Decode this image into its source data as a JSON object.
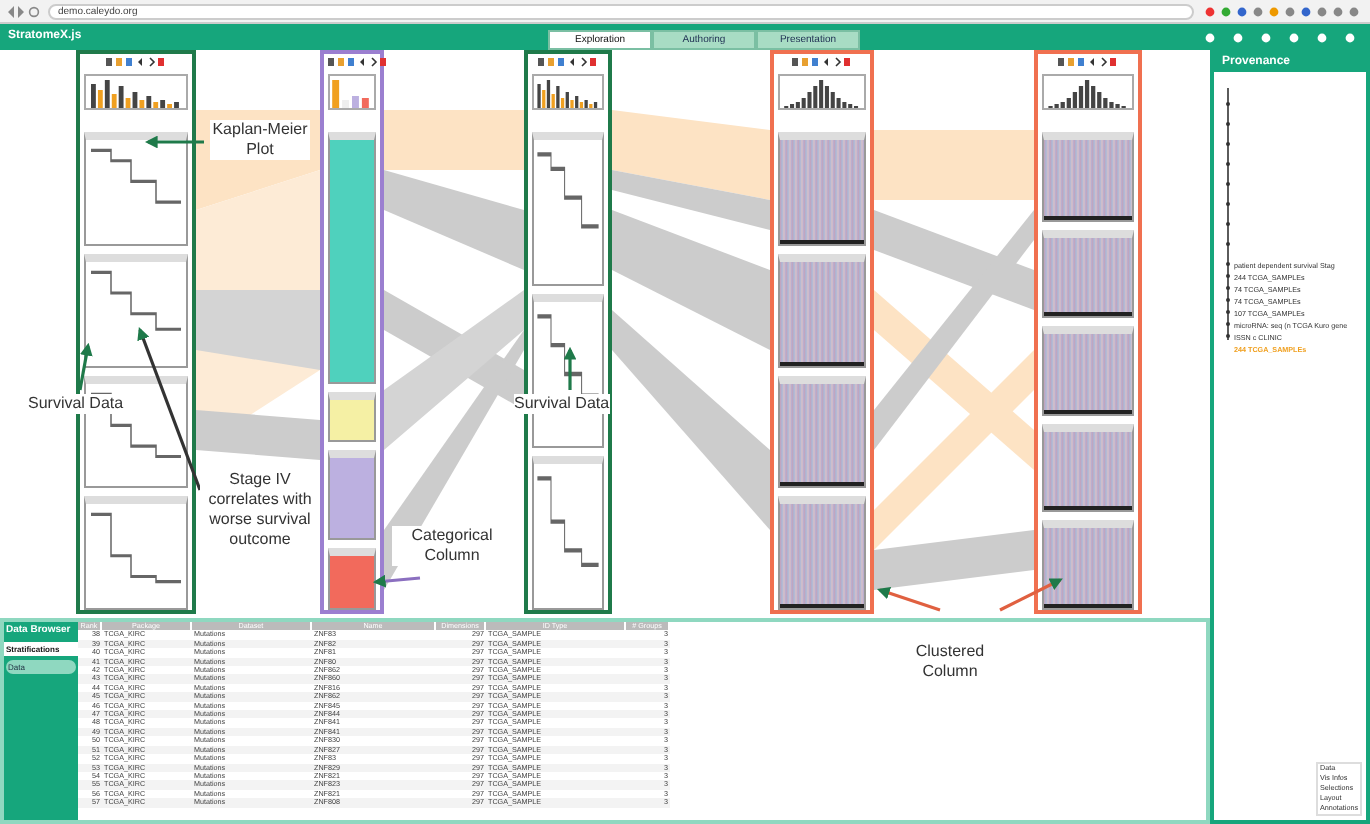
{
  "browser": {
    "url": "demo.caleydo.org"
  },
  "app": {
    "title": "StratomeX.js"
  },
  "tabs": [
    {
      "label": "Exploration",
      "selected": true
    },
    {
      "label": "Authoring",
      "selected": false
    },
    {
      "label": "Presentation",
      "selected": false
    }
  ],
  "columns": [
    {
      "kind": "survival",
      "groups": [
        {
          "kind": "km"
        },
        {
          "kind": "km"
        },
        {
          "kind": "km"
        },
        {
          "kind": "km"
        }
      ]
    },
    {
      "kind": "categorical",
      "groups": [
        {
          "kind": "block",
          "color": "#4fd1bd"
        },
        {
          "kind": "block",
          "color": "#f5f0a4"
        },
        {
          "kind": "block",
          "color": "#bcb0e0"
        },
        {
          "kind": "block",
          "color": "#f26a5c"
        }
      ]
    },
    {
      "kind": "survival",
      "groups": [
        {
          "kind": "km"
        },
        {
          "kind": "km"
        },
        {
          "kind": "km"
        }
      ]
    },
    {
      "kind": "clustered",
      "groups": [
        {
          "kind": "heatmap"
        },
        {
          "kind": "heatmap"
        },
        {
          "kind": "heatmap"
        },
        {
          "kind": "heatmap"
        }
      ]
    },
    {
      "kind": "clustered",
      "groups": [
        {
          "kind": "heatmap"
        },
        {
          "kind": "heatmap"
        },
        {
          "kind": "heatmap"
        },
        {
          "kind": "heatmap"
        },
        {
          "kind": "heatmap"
        }
      ]
    }
  ],
  "annotations": [
    {
      "text": "Kaplan-Meier Plot"
    },
    {
      "text": "Survival Data"
    },
    {
      "text": "Stage IV correlates with worse survival outcome"
    },
    {
      "text": "Categorical Column"
    },
    {
      "text": "Survival Data"
    },
    {
      "text": "Clustered Column"
    }
  ],
  "data_browser": {
    "title": "Data Browser",
    "tabs": [
      {
        "label": "Stratifications",
        "selected": true
      },
      {
        "label": "Data",
        "selected": false
      }
    ],
    "columns": [
      "Rank",
      "Package",
      "Dataset",
      "Name",
      "Dimensions",
      "ID Type",
      "# Groups"
    ],
    "rows": [
      [
        "38",
        "TCGA_KIRC",
        "Mutations",
        "ZNF83",
        "297",
        "TCGA_SAMPLE",
        "3"
      ],
      [
        "39",
        "TCGA_KIRC",
        "Mutations",
        "ZNF82",
        "297",
        "TCGA_SAMPLE",
        "3"
      ],
      [
        "40",
        "TCGA_KIRC",
        "Mutations",
        "ZNF81",
        "297",
        "TCGA_SAMPLE",
        "3"
      ],
      [
        "41",
        "TCGA_KIRC",
        "Mutations",
        "ZNF80",
        "297",
        "TCGA_SAMPLE",
        "3"
      ],
      [
        "42",
        "TCGA_KIRC",
        "Mutations",
        "ZNF862",
        "297",
        "TCGA_SAMPLE",
        "3"
      ],
      [
        "43",
        "TCGA_KIRC",
        "Mutations",
        "ZNF860",
        "297",
        "TCGA_SAMPLE",
        "3"
      ],
      [
        "44",
        "TCGA_KIRC",
        "Mutations",
        "ZNF816",
        "297",
        "TCGA_SAMPLE",
        "3"
      ],
      [
        "45",
        "TCGA_KIRC",
        "Mutations",
        "ZNF862",
        "297",
        "TCGA_SAMPLE",
        "3"
      ],
      [
        "46",
        "TCGA_KIRC",
        "Mutations",
        "ZNF845",
        "297",
        "TCGA_SAMPLE",
        "3"
      ],
      [
        "47",
        "TCGA_KIRC",
        "Mutations",
        "ZNF844",
        "297",
        "TCGA_SAMPLE",
        "3"
      ],
      [
        "48",
        "TCGA_KIRC",
        "Mutations",
        "ZNF841",
        "297",
        "TCGA_SAMPLE",
        "3"
      ],
      [
        "49",
        "TCGA_KIRC",
        "Mutations",
        "ZNF841",
        "297",
        "TCGA_SAMPLE",
        "3"
      ],
      [
        "50",
        "TCGA_KIRC",
        "Mutations",
        "ZNF830",
        "297",
        "TCGA_SAMPLE",
        "3"
      ],
      [
        "51",
        "TCGA_KIRC",
        "Mutations",
        "ZNF827",
        "297",
        "TCGA_SAMPLE",
        "3"
      ],
      [
        "52",
        "TCGA_KIRC",
        "Mutations",
        "ZNF83",
        "297",
        "TCGA_SAMPLE",
        "3"
      ],
      [
        "53",
        "TCGA_KIRC",
        "Mutations",
        "ZNF829",
        "297",
        "TCGA_SAMPLE",
        "3"
      ],
      [
        "54",
        "TCGA_KIRC",
        "Mutations",
        "ZNF821",
        "297",
        "TCGA_SAMPLE",
        "3"
      ],
      [
        "55",
        "TCGA_KIRC",
        "Mutations",
        "ZNF823",
        "297",
        "TCGA_SAMPLE",
        "3"
      ],
      [
        "56",
        "TCGA_KIRC",
        "Mutations",
        "ZNF821",
        "297",
        "TCGA_SAMPLE",
        "3"
      ],
      [
        "57",
        "TCGA_KIRC",
        "Mutations",
        "ZNF808",
        "297",
        "TCGA_SAMPLE",
        "3"
      ]
    ]
  },
  "provenance": {
    "title": "Provenance",
    "items": [
      {
        "text": "patient dependent survival Stag",
        "selected": false
      },
      {
        "text": "244 TCGA_SAMPLEs",
        "selected": false
      },
      {
        "text": "74 TCGA_SAMPLEs",
        "selected": false
      },
      {
        "text": "74 TCGA_SAMPLEs",
        "selected": false
      },
      {
        "text": "107 TCGA_SAMPLEs",
        "selected": false
      },
      {
        "text": "microRNA: seq (n TCGA Kuro gene",
        "selected": false
      },
      {
        "text": "ISSN c CLINIC",
        "selected": false
      },
      {
        "text": "244 TCGA_SAMPLEs",
        "selected": true
      }
    ],
    "legend": [
      "Data",
      "Vis Infos",
      "Selections",
      "Layout",
      "Annotations"
    ]
  }
}
